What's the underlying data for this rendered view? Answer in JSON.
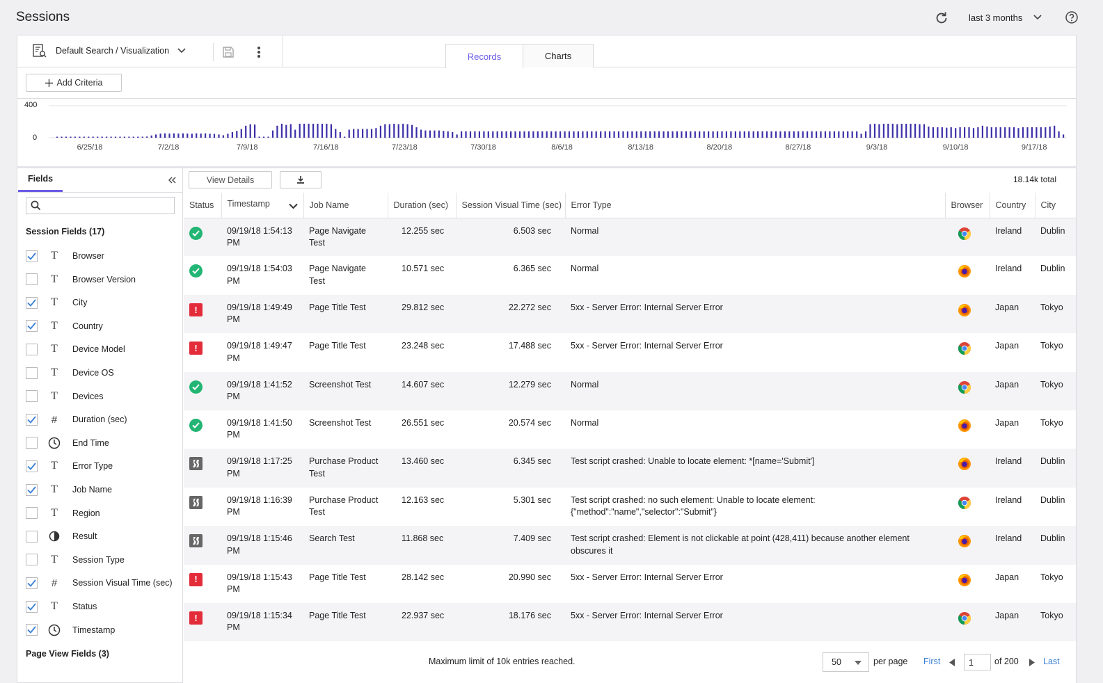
{
  "app": {
    "title": "Sessions",
    "time_range": "last 3 months"
  },
  "toolbar": {
    "search_select": "Default Search / Visualization",
    "add_criteria": "Add Criteria"
  },
  "tabs": [
    {
      "label": "Records",
      "active": true
    },
    {
      "label": "Charts",
      "active": false
    }
  ],
  "histogram": {
    "y_ticks": [
      "400",
      "0"
    ],
    "x_ticks": [
      "6/25/18",
      "7/2/18",
      "7/9/18",
      "7/16/18",
      "7/23/18",
      "7/30/18",
      "8/6/18",
      "8/13/18",
      "8/20/18",
      "8/27/18",
      "9/3/18",
      "9/10/18",
      "9/17/18"
    ],
    "ymax": 400,
    "bar_color": "#3b2fa8",
    "values": [
      12,
      10,
      12,
      10,
      12,
      10,
      12,
      10,
      10,
      10,
      12,
      10,
      12,
      10,
      12,
      10,
      12,
      10,
      12,
      10,
      15,
      28,
      40,
      52,
      55,
      52,
      55,
      52,
      55,
      52,
      50,
      55,
      52,
      55,
      50,
      48,
      40,
      30,
      50,
      70,
      85,
      110,
      150,
      170,
      165,
      10,
      10,
      12,
      90,
      150,
      175,
      160,
      170,
      100,
      175,
      175,
      175,
      175,
      175,
      175,
      175,
      170,
      110,
      70,
      10,
      100,
      110,
      110,
      110,
      110,
      110,
      120,
      150,
      170,
      170,
      175,
      170,
      175,
      170,
      160,
      130,
      100,
      90,
      90,
      90,
      90,
      85,
      80,
      70,
      40,
      80,
      80,
      80,
      80,
      80,
      80,
      80,
      80,
      80,
      80,
      80,
      80,
      80,
      80,
      80,
      80,
      80,
      80,
      80,
      80,
      80,
      80,
      80,
      80,
      80,
      80,
      80,
      80,
      80,
      80,
      80,
      80,
      80,
      80,
      80,
      80,
      80,
      80,
      80,
      80,
      80,
      80,
      80,
      80,
      80,
      80,
      80,
      80,
      80,
      80,
      80,
      80,
      80,
      80,
      80,
      80,
      80,
      80,
      80,
      80,
      80,
      80,
      80,
      80,
      80,
      80,
      80,
      80,
      80,
      80,
      80,
      80,
      80,
      80,
      80,
      80,
      80,
      80,
      80,
      80,
      80,
      80,
      80,
      80,
      80,
      80,
      80,
      80,
      80,
      50,
      80,
      170,
      175,
      170,
      175,
      175,
      175,
      170,
      175,
      175,
      175,
      175,
      170,
      170,
      140,
      130,
      130,
      130,
      125,
      130,
      120,
      130,
      130,
      130,
      120,
      130,
      150,
      140,
      130,
      130,
      130,
      130,
      130,
      130,
      120,
      130,
      130,
      130,
      130,
      130,
      130,
      140,
      150,
      80,
      40
    ],
    "sample_count": 232
  },
  "fields_panel": {
    "tab": "Fields",
    "search_placeholder": "",
    "session_section": "Session Fields (17)",
    "page_section": "Page View Fields (3)",
    "items": [
      {
        "label": "Browser",
        "checked": true,
        "type": "T"
      },
      {
        "label": "Browser Version",
        "checked": false,
        "type": "T"
      },
      {
        "label": "City",
        "checked": true,
        "type": "T"
      },
      {
        "label": "Country",
        "checked": true,
        "type": "T"
      },
      {
        "label": "Device Model",
        "checked": false,
        "type": "T"
      },
      {
        "label": "Device OS",
        "checked": false,
        "type": "T"
      },
      {
        "label": "Devices",
        "checked": false,
        "type": "T"
      },
      {
        "label": "Duration (sec)",
        "checked": true,
        "type": "#"
      },
      {
        "label": "End Time",
        "checked": false,
        "type": "clock"
      },
      {
        "label": "Error Type",
        "checked": true,
        "type": "T"
      },
      {
        "label": "Job Name",
        "checked": true,
        "type": "T"
      },
      {
        "label": "Region",
        "checked": false,
        "type": "T"
      },
      {
        "label": "Result",
        "checked": false,
        "type": "half"
      },
      {
        "label": "Session Type",
        "checked": false,
        "type": "T"
      },
      {
        "label": "Session Visual Time (sec)",
        "checked": true,
        "type": "#"
      },
      {
        "label": "Status",
        "checked": true,
        "type": "T"
      },
      {
        "label": "Timestamp",
        "checked": true,
        "type": "clock"
      }
    ]
  },
  "results": {
    "view_details": "View Details",
    "total": "18.14k total",
    "columns": [
      "Status",
      "Timestamp",
      "Job Name",
      "Duration (sec)",
      "Session Visual Time (sec)",
      "Error Type",
      "Browser",
      "Country",
      "City"
    ],
    "rows": [
      {
        "status": "ok",
        "timestamp": "09/19/18 1:54:13 PM",
        "job": "Page Navigate Test",
        "duration": "12.255 sec",
        "visual": "6.503 sec",
        "error": "Normal",
        "browser": "chrome",
        "country": "Ireland",
        "city": "Dublin"
      },
      {
        "status": "ok",
        "timestamp": "09/19/18 1:54:03 PM",
        "job": "Page Navigate Test",
        "duration": "10.571 sec",
        "visual": "6.365 sec",
        "error": "Normal",
        "browser": "firefox",
        "country": "Ireland",
        "city": "Dublin"
      },
      {
        "status": "err",
        "timestamp": "09/19/18 1:49:49 PM",
        "job": "Page Title Test",
        "duration": "29.812 sec",
        "visual": "22.272 sec",
        "error": "5xx - Server Error: Internal Server Error",
        "browser": "firefox",
        "country": "Japan",
        "city": "Tokyo"
      },
      {
        "status": "err",
        "timestamp": "09/19/18 1:49:47 PM",
        "job": "Page Title Test",
        "duration": "23.248 sec",
        "visual": "17.488 sec",
        "error": "5xx - Server Error: Internal Server Error",
        "browser": "chrome",
        "country": "Japan",
        "city": "Tokyo"
      },
      {
        "status": "ok",
        "timestamp": "09/19/18 1:41:52 PM",
        "job": "Screenshot Test",
        "duration": "14.607 sec",
        "visual": "12.279 sec",
        "error": "Normal",
        "browser": "chrome",
        "country": "Japan",
        "city": "Tokyo"
      },
      {
        "status": "ok",
        "timestamp": "09/19/18 1:41:50 PM",
        "job": "Screenshot Test",
        "duration": "26.551 sec",
        "visual": "20.574 sec",
        "error": "Normal",
        "browser": "firefox",
        "country": "Japan",
        "city": "Tokyo"
      },
      {
        "status": "crash",
        "timestamp": "09/19/18 1:17:25 PM",
        "job": "Purchase Product Test",
        "duration": "13.460 sec",
        "visual": "6.345 sec",
        "error": "Test script crashed: Unable to locate element: *[name='Submit']",
        "browser": "firefox",
        "country": "Ireland",
        "city": "Dublin"
      },
      {
        "status": "crash",
        "timestamp": "09/19/18 1:16:39 PM",
        "job": "Purchase Product Test",
        "duration": "12.163 sec",
        "visual": "5.301 sec",
        "error": "Test script crashed: no such element: Unable to locate element: {\"method\":\"name\",\"selector\":\"Submit\"}",
        "browser": "chrome",
        "country": "Ireland",
        "city": "Dublin"
      },
      {
        "status": "crash",
        "timestamp": "09/19/18 1:15:46 PM",
        "job": "Search Test",
        "duration": "11.868 sec",
        "visual": "7.409 sec",
        "error": "Test script crashed: Element  is not clickable at point (428,411) because another element  obscures it",
        "browser": "firefox",
        "country": "Ireland",
        "city": "Dublin"
      },
      {
        "status": "err",
        "timestamp": "09/19/18 1:15:43 PM",
        "job": "Page Title Test",
        "duration": "28.142 sec",
        "visual": "20.990 sec",
        "error": "5xx - Server Error: Internal Server Error",
        "browser": "firefox",
        "country": "Japan",
        "city": "Tokyo"
      },
      {
        "status": "err",
        "timestamp": "09/19/18 1:15:34 PM",
        "job": "Page Title Test",
        "duration": "22.937 sec",
        "visual": "18.176 sec",
        "error": "5xx - Server Error: Internal Server Error",
        "browser": "chrome",
        "country": "Japan",
        "city": "Tokyo"
      }
    ]
  },
  "footer": {
    "limit_message": "Maximum limit of 10k entries reached.",
    "per_page_value": "50",
    "per_page_label": "per page",
    "first": "First",
    "page": "1",
    "of_pages": "of 200",
    "last": "Last"
  },
  "colors": {
    "accent": "#6b5ce7",
    "ok": "#22b573",
    "error": "#e32c3a",
    "crash": "#666666",
    "link": "#3a7fd5"
  }
}
